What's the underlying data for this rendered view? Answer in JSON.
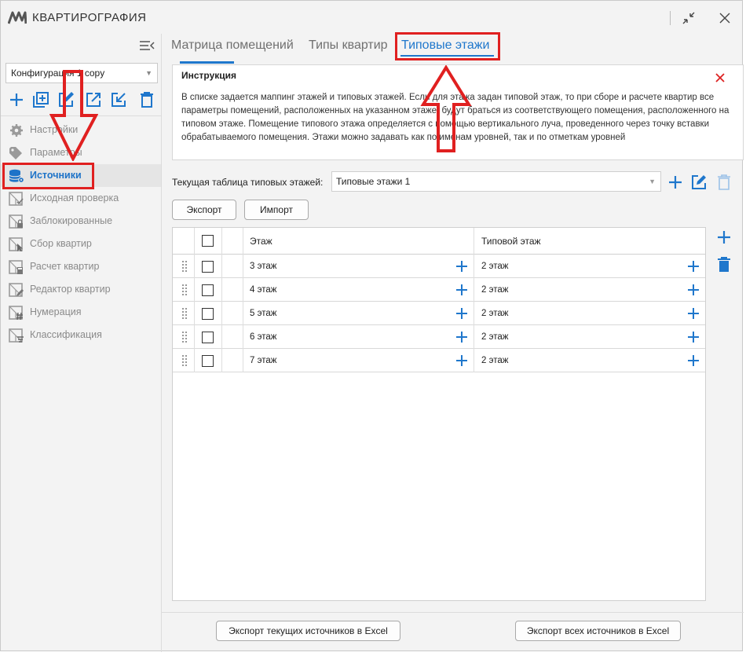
{
  "app": {
    "title": "КВАРТИРОГРАФИЯ"
  },
  "sidebar": {
    "config_value": "Конфигурация 1 copy",
    "toolbar_icons": [
      "plus-icon",
      "add-copy-icon",
      "edit-icon",
      "export-icon",
      "import-icon",
      "trash-icon"
    ],
    "items": [
      {
        "label": "Настройки",
        "icon": "gear-icon"
      },
      {
        "label": "Параметры",
        "icon": "tag-icon"
      },
      {
        "label": "Источники",
        "icon": "database-gear-icon",
        "active": true
      },
      {
        "label": "Исходная проверка",
        "icon": "check-plan-icon"
      },
      {
        "label": "Заблокированные",
        "icon": "lock-plan-icon"
      },
      {
        "label": "Сбор квартир",
        "icon": "cursor-plan-icon"
      },
      {
        "label": "Расчет квартир",
        "icon": "calc-plan-icon"
      },
      {
        "label": "Редактор квартир",
        "icon": "edit-plan-icon"
      },
      {
        "label": "Нумерация",
        "icon": "hash-plan-icon"
      },
      {
        "label": "Классификация",
        "icon": "sort-plan-icon"
      }
    ]
  },
  "tabs": [
    {
      "label": "Матрица помещений"
    },
    {
      "label": "Типы квартир"
    },
    {
      "label": "Типовые этажи",
      "active": true
    }
  ],
  "instruction": {
    "title": "Инструкция",
    "text": "В списке задается маппинг этажей и типовых этажей. Если для этажа задан типовой этаж, то при сборе и расчете квартир все параметры помещений, расположенных на указанном этаже, будут браться из соответствующего помещения, расположенного на типовом этаже. Помещение типового этажа определяется с помощью вертикального луча, проведенного через точку вставки обрабатываемого помещения. Этажи можно задавать как по именам уровней, так и по отметкам уровней"
  },
  "table_selector": {
    "label": "Текущая таблица типовых этажей:",
    "value": "Типовые этажи 1"
  },
  "buttons": {
    "export": "Экспорт",
    "import": "Импорт"
  },
  "grid": {
    "headers": {
      "floor": "Этаж",
      "typical": "Типовой этаж"
    },
    "rows": [
      {
        "floor": "3 этаж",
        "typical": "2 этаж"
      },
      {
        "floor": "4 этаж",
        "typical": "2 этаж"
      },
      {
        "floor": "5 этаж",
        "typical": "2 этаж"
      },
      {
        "floor": "6 этаж",
        "typical": "2 этаж"
      },
      {
        "floor": "7 этаж",
        "typical": "2 этаж"
      }
    ]
  },
  "footer": {
    "export_current": "Экспорт текущих источников в Excel",
    "export_all": "Экспорт всех источников в Excel"
  },
  "colors": {
    "accent": "#1f77cc",
    "annotation": "#e02020"
  }
}
